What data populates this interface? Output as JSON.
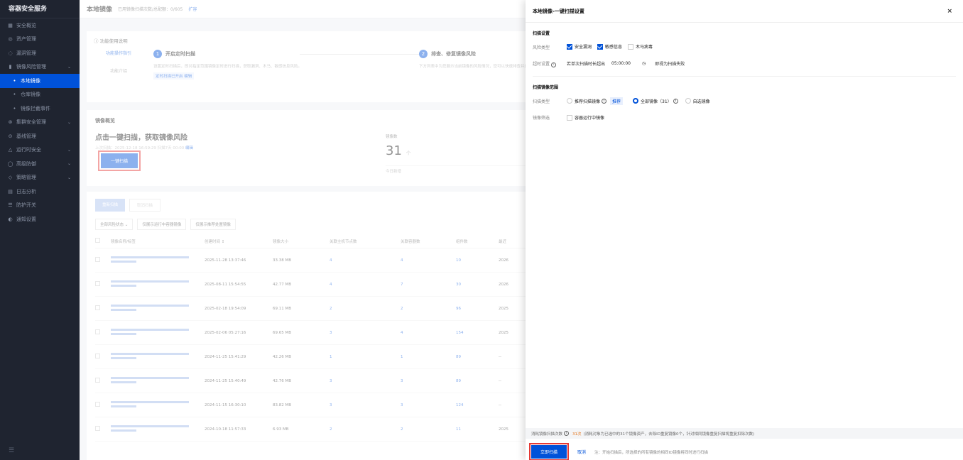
{
  "sidebar": {
    "brand": "容器安全服务",
    "items": [
      {
        "icon": "grid-icon",
        "glyph": "▦",
        "label": "安全概览",
        "arrow": ""
      },
      {
        "icon": "asset-icon",
        "glyph": "◎",
        "label": "资产管理",
        "arrow": ""
      },
      {
        "icon": "vuln-icon",
        "glyph": "◌",
        "label": "漏洞管理",
        "arrow": ""
      },
      {
        "icon": "image-risk-icon",
        "glyph": "▮",
        "label": "镜像风险管理",
        "arrow": "⌄"
      },
      {
        "icon": "",
        "glyph": "•",
        "label": "本地镜像",
        "arrow": "",
        "active": true,
        "sub": true
      },
      {
        "icon": "",
        "glyph": "•",
        "label": "仓库镜像",
        "arrow": "",
        "sub": true
      },
      {
        "icon": "",
        "glyph": "•",
        "label": "镜像拦截事件",
        "arrow": "",
        "sub": true
      },
      {
        "icon": "cluster-icon",
        "glyph": "⊛",
        "label": "集群安全管理",
        "arrow": "⌄"
      },
      {
        "icon": "baseline-icon",
        "glyph": "⊝",
        "label": "基线管理",
        "arrow": ""
      },
      {
        "icon": "runtime-icon",
        "glyph": "△",
        "label": "运行时安全",
        "arrow": "⌄"
      },
      {
        "icon": "defense-icon",
        "glyph": "◯",
        "label": "高级防御",
        "arrow": "⌄"
      },
      {
        "icon": "policy-icon",
        "glyph": "◇",
        "label": "策略管理",
        "arrow": "⌄"
      },
      {
        "icon": "log-icon",
        "glyph": "▤",
        "label": "日志分析",
        "arrow": ""
      },
      {
        "icon": "switch-icon",
        "glyph": "☰",
        "label": "防护开关",
        "arrow": ""
      },
      {
        "icon": "notify-icon",
        "glyph": "◐",
        "label": "通知设置",
        "arrow": ""
      }
    ],
    "footer_glyph": "☰"
  },
  "topbar": {
    "title": "本地镜像",
    "quota": "已用镜像扫描次数/总配额：0/605",
    "expand": "扩容"
  },
  "guide": {
    "header": "ⓘ 功能使用说明",
    "side_link": "功能操作指引",
    "side_plain": "功能介绍",
    "step1": {
      "num": "1",
      "title": "开启定时扫描",
      "desc": "设置定时扫描后，即对指定范围镜像定时进行扫描，获取漏洞、木马、敏感信息风险。",
      "tag": "定时扫描已开启 编辑"
    },
    "step2": {
      "num": "2",
      "title": "排查、修复镜像风险",
      "desc": "下方列表中为您展示当前镜像的风险情况，您可以快速排查并进行修复。"
    }
  },
  "overview": {
    "section": "镜像概览",
    "headline": "点击一键扫描，获取镜像风险",
    "last_scan": "上次扫描：2025-12-18 16:59:29  扫描7天 00:00",
    "edit": "编辑",
    "scan_button": "一键扫描",
    "metric_label": "镜像数",
    "metric_value": "31",
    "metric_unit": "个",
    "today": "今日新增"
  },
  "table": {
    "btn_scan": "重新扫描",
    "btn_cancel": "取消扫描",
    "filter_status": "全部风险状态  ⌄",
    "filter_running": "仅展示运行中容器镜像",
    "filter_recommend": "仅展示推荐处置镜像",
    "headers": [
      "镜像名称/标签",
      "创建时间 ↕",
      "镜像大小",
      "关联主机节点数",
      "关联容器数",
      "组件数",
      "最近"
    ],
    "rows": [
      {
        "time": "2025-11-28 13:37:46",
        "size": "33.38 MB",
        "hosts": "4",
        "containers": "4",
        "components": "10",
        "recent": "2026"
      },
      {
        "time": "2025-08-11 15:54:55",
        "size": "42.77 MB",
        "hosts": "4",
        "containers": "7",
        "components": "30",
        "recent": "2026"
      },
      {
        "time": "2025-02-18 19:54:09",
        "size": "69.11 MB",
        "hosts": "2",
        "containers": "2",
        "components": "96",
        "recent": "2025"
      },
      {
        "time": "2025-02-06 05:27:16",
        "size": "69.65 MB",
        "hosts": "3",
        "containers": "4",
        "components": "154",
        "recent": "2025"
      },
      {
        "time": "2024-11-25 15:41:29",
        "size": "42.26 MB",
        "hosts": "1",
        "containers": "1",
        "components": "89",
        "recent": "--"
      },
      {
        "time": "2024-11-25 15:40:49",
        "size": "42.76 MB",
        "hosts": "3",
        "containers": "3",
        "components": "89",
        "recent": "--"
      },
      {
        "time": "2024-11-15 16:30:10",
        "size": "83.82 MB",
        "hosts": "3",
        "containers": "3",
        "components": "124",
        "recent": "--"
      },
      {
        "time": "2024-10-18 11:57:33",
        "size": "6.93 MB",
        "hosts": "2",
        "containers": "2",
        "components": "11",
        "recent": "2025"
      }
    ]
  },
  "drawer": {
    "title": "本地镜像-一键扫描设置",
    "close": "×",
    "scan_settings": "扫描设置",
    "risk_type_label": "风险类型",
    "risk_types": [
      {
        "label": "安全漏洞",
        "checked": true
      },
      {
        "label": "敏感信息",
        "checked": true
      },
      {
        "label": "木马病毒",
        "checked": false
      }
    ],
    "timeout_label": "超时设置",
    "timeout_prefix": "若单次扫描时长超出",
    "timeout_value": "05:00:00",
    "timeout_suffix": "即视为扫描失败",
    "scope_title": "扫描镜像范围",
    "scan_type_label": "扫描类型",
    "scan_types": [
      {
        "label": "推荐扫描镜像",
        "selected": false,
        "tag": "推荐"
      },
      {
        "label": "全部镜像（31）",
        "selected": true,
        "tag": ""
      },
      {
        "label": "自选镜像",
        "selected": false,
        "tag": ""
      }
    ],
    "filter_label": "镜像筛选",
    "filter_option": "容器运行中镜像",
    "consume_label": "消耗镜像扫描次数",
    "consume_value": "31次",
    "consume_desc": "(消耗对象为已选中的31个镜像资产，去除ID重复镜像0个，针对相同镜像重复扫描将重复扣除次数)",
    "confirm": "立即扫描",
    "cancel": "取消",
    "note": "注：开始扫描后，所选择的所有镜像的相同ID镜像将同时进行扫描"
  }
}
